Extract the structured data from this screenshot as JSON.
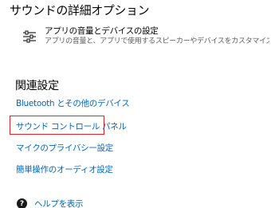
{
  "advanced": {
    "title": "サウンドの詳細オプション",
    "app_volume": {
      "title": "アプリの音量とデバイスの設定",
      "description": "アプリの音量と、アプリで使用するスピーカーやデバイスをカスタマイズします。",
      "icon": "sliders-icon"
    }
  },
  "related": {
    "title": "関連設定",
    "links": [
      "Bluetooth とその他のデバイス",
      "サウンド コントロール パネル",
      "マイクのプライバシー設定",
      "簡単操作のオーディオ設定"
    ]
  },
  "help": {
    "label": "ヘルプを表示",
    "icon": "help-icon"
  },
  "colors": {
    "link": "#0067c0",
    "highlight_border": "#e0252a"
  }
}
